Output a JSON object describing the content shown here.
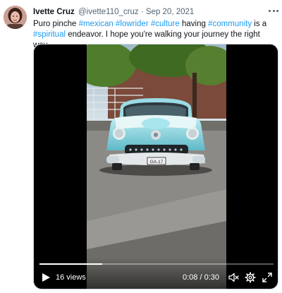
{
  "tweet": {
    "author": {
      "display_name": "Ivette Cruz",
      "handle": "@ivette110_cruz",
      "separator": "·",
      "date": "Sep 20, 2021"
    },
    "text": [
      {
        "t": "Puro pinche ",
        "tag": false
      },
      {
        "t": "#mexican",
        "tag": true
      },
      {
        "t": " ",
        "tag": false
      },
      {
        "t": "#lowrider",
        "tag": true
      },
      {
        "t": " ",
        "tag": false
      },
      {
        "t": "#culture",
        "tag": true
      },
      {
        "t": " having ",
        "tag": false
      },
      {
        "t": "#community",
        "tag": true
      },
      {
        "t": " is a ",
        "tag": false
      },
      {
        "t": "#spiritual",
        "tag": true
      },
      {
        "t": " endeavor. I hope you're walking your journey the right way.",
        "tag": false
      }
    ],
    "video": {
      "views": "16 views",
      "current_time": "0:08",
      "time_separator": " / ",
      "duration": "0:30",
      "progress_fraction": 0.267,
      "plate_text": "GA-17"
    }
  },
  "icons": {
    "more": "more-horizontal-icon",
    "play": "play-icon",
    "mute": "volume-muted-icon",
    "settings": "gear-icon",
    "fullscreen": "fullscreen-icon"
  },
  "colors": {
    "link": "#1d9bf0",
    "secondary_text": "#536471",
    "primary_text": "#0f1419",
    "car": "#8fd3dc"
  }
}
